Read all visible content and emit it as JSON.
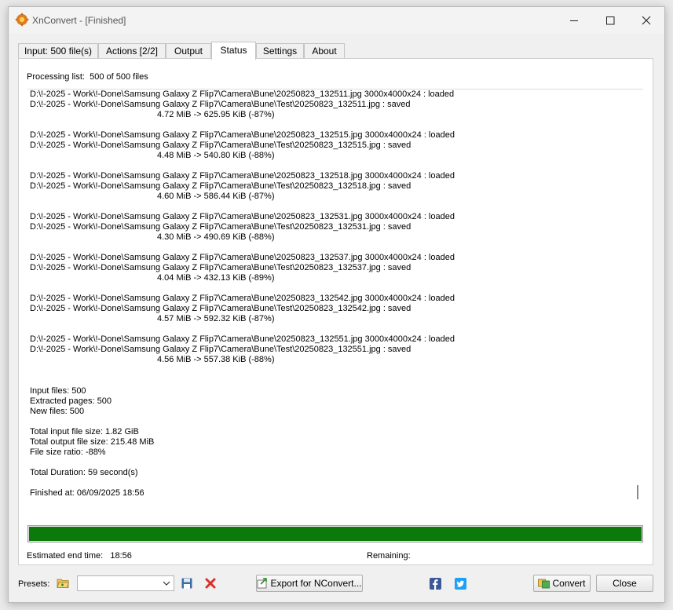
{
  "window": {
    "title": "XnConvert - [Finished]"
  },
  "tabs": [
    {
      "label": "Input: 500 file(s)",
      "active": false
    },
    {
      "label": "Actions [2/2]",
      "active": false
    },
    {
      "label": "Output",
      "active": false
    },
    {
      "label": "Status",
      "active": true
    },
    {
      "label": "Settings",
      "active": false
    },
    {
      "label": "About",
      "active": false
    }
  ],
  "status": {
    "processing_label": "Processing list:",
    "processing_value": "500 of 500 files",
    "log": {
      "entries": [
        {
          "loaded": "D:\\!-2025 - Work\\!-Done\\Samsung Galaxy Z Flip7\\Camera\\Bune\\20250823_132511.jpg 3000x4000x24 : loaded",
          "saved": "D:\\!-2025 - Work\\!-Done\\Samsung Galaxy Z Flip7\\Camera\\Bune\\Test\\20250823_132511.jpg : saved",
          "size": "4.72 MiB -> 625.95 KiB (-87%)"
        },
        {
          "loaded": "D:\\!-2025 - Work\\!-Done\\Samsung Galaxy Z Flip7\\Camera\\Bune\\20250823_132515.jpg 3000x4000x24 : loaded",
          "saved": "D:\\!-2025 - Work\\!-Done\\Samsung Galaxy Z Flip7\\Camera\\Bune\\Test\\20250823_132515.jpg : saved",
          "size": "4.48 MiB -> 540.80 KiB (-88%)"
        },
        {
          "loaded": "D:\\!-2025 - Work\\!-Done\\Samsung Galaxy Z Flip7\\Camera\\Bune\\20250823_132518.jpg 3000x4000x24 : loaded",
          "saved": "D:\\!-2025 - Work\\!-Done\\Samsung Galaxy Z Flip7\\Camera\\Bune\\Test\\20250823_132518.jpg : saved",
          "size": "4.60 MiB -> 586.44 KiB (-87%)"
        },
        {
          "loaded": "D:\\!-2025 - Work\\!-Done\\Samsung Galaxy Z Flip7\\Camera\\Bune\\20250823_132531.jpg 3000x4000x24 : loaded",
          "saved": "D:\\!-2025 - Work\\!-Done\\Samsung Galaxy Z Flip7\\Camera\\Bune\\Test\\20250823_132531.jpg : saved",
          "size": "4.30 MiB -> 490.69 KiB (-88%)"
        },
        {
          "loaded": "D:\\!-2025 - Work\\!-Done\\Samsung Galaxy Z Flip7\\Camera\\Bune\\20250823_132537.jpg 3000x4000x24 : loaded",
          "saved": "D:\\!-2025 - Work\\!-Done\\Samsung Galaxy Z Flip7\\Camera\\Bune\\Test\\20250823_132537.jpg : saved",
          "size": "4.04 MiB -> 432.13 KiB (-89%)"
        },
        {
          "loaded": "D:\\!-2025 - Work\\!-Done\\Samsung Galaxy Z Flip7\\Camera\\Bune\\20250823_132542.jpg 3000x4000x24 : loaded",
          "saved": "D:\\!-2025 - Work\\!-Done\\Samsung Galaxy Z Flip7\\Camera\\Bune\\Test\\20250823_132542.jpg : saved",
          "size": "4.57 MiB -> 592.32 KiB (-87%)"
        },
        {
          "loaded": "D:\\!-2025 - Work\\!-Done\\Samsung Galaxy Z Flip7\\Camera\\Bune\\20250823_132551.jpg 3000x4000x24 : loaded",
          "saved": "D:\\!-2025 - Work\\!-Done\\Samsung Galaxy Z Flip7\\Camera\\Bune\\Test\\20250823_132551.jpg : saved",
          "size": "4.56 MiB -> 557.38 KiB (-88%)"
        }
      ],
      "summary": {
        "input_files": "Input files: 500",
        "extracted_pages": "Extracted pages: 500",
        "new_files": "New files: 500",
        "total_input": "Total input file size: 1.82 GiB",
        "total_output": "Total output file size: 215.48 MiB",
        "ratio": "File size ratio: -88%",
        "duration": "Total Duration: 59 second(s)",
        "finished": "Finished at: 06/09/2025 18:56"
      }
    },
    "progress_fraction": 1.0,
    "progress_color": "#0b7a0b",
    "estimated_end_label": "Estimated end time:",
    "estimated_end_value": "18:56",
    "remaining_label": "Remaining:"
  },
  "footer": {
    "presets_label": "Presets:",
    "preset_value": "",
    "export_label": "Export for NConvert...",
    "convert_label": "Convert",
    "close_label": "Close"
  },
  "colors": {
    "facebook": "#3b5998",
    "twitter": "#1da1f2",
    "delete": "#d9302c",
    "save": "#3a6ea5"
  }
}
